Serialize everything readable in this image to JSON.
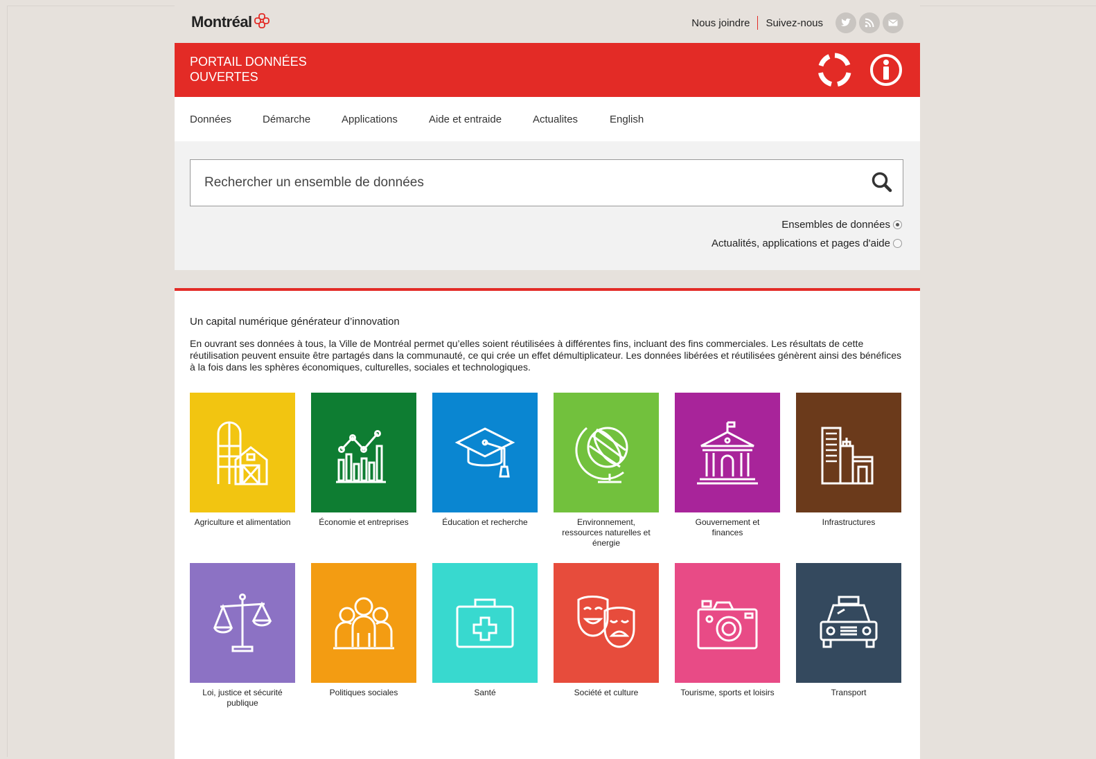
{
  "header": {
    "logo_text": "Montréal",
    "contact_label": "Nous joindre",
    "follow_label": "Suivez-nous",
    "social_icons": [
      "twitter-icon",
      "rss-icon",
      "email-icon"
    ]
  },
  "banner": {
    "title_line1": "PORTAIL DONNÉES",
    "title_line2": "OUVERTES",
    "icons": [
      "open-data-ring-icon",
      "info-icon"
    ]
  },
  "nav": {
    "items": [
      {
        "label": "Données"
      },
      {
        "label": "Démarche"
      },
      {
        "label": "Applications"
      },
      {
        "label": "Aide et entraide"
      },
      {
        "label": "Actualites"
      },
      {
        "label": "English"
      }
    ]
  },
  "search": {
    "placeholder": "Rechercher un ensemble de données",
    "options": [
      {
        "label": "Ensembles de données",
        "selected": true
      },
      {
        "label": "Actualités, applications et pages d'aide",
        "selected": false
      }
    ]
  },
  "intro": {
    "heading": "Un capital numérique générateur d’innovation",
    "paragraph": "En ouvrant ses données à tous, la Ville de Montréal permet qu’elles soient réutilisées à différentes fins, incluant des fins commerciales. Les résultats de cette réutilisation peuvent ensuite être partagés dans la communauté, ce qui crée un effet démultiplicateur. Les données libérées et réutilisées génèrent ainsi des bénéfices à la fois dans les sphères économiques, culturelles, sociales et technologiques."
  },
  "categories": [
    {
      "label": "Agriculture et alimentation",
      "color": "#f2c511",
      "icon": "farm-silo-icon"
    },
    {
      "label": "Économie et entreprises",
      "color": "#0e7d32",
      "icon": "bar-chart-trend-icon"
    },
    {
      "label": "Éducation et recherche",
      "color": "#0a86d1",
      "icon": "graduation-cap-icon"
    },
    {
      "label": "Environnement, ressources naturelles et énergie",
      "color": "#72c13d",
      "icon": "globe-icon"
    },
    {
      "label": "Gouvernement et finances",
      "color": "#a8249a",
      "icon": "government-building-icon"
    },
    {
      "label": "Infrastructures",
      "color": "#6b3a1b",
      "icon": "buildings-icon"
    },
    {
      "label": "Loi, justice et sécurité publique",
      "color": "#8c72c4",
      "icon": "scales-icon"
    },
    {
      "label": "Politiques sociales",
      "color": "#f39c12",
      "icon": "people-group-icon"
    },
    {
      "label": "Santé",
      "color": "#38d9cf",
      "icon": "medical-kit-icon"
    },
    {
      "label": "Société et culture",
      "color": "#e74c3c",
      "icon": "theater-masks-icon"
    },
    {
      "label": "Tourisme, sports et loisirs",
      "color": "#e84b86",
      "icon": "camera-icon"
    },
    {
      "label": "Transport",
      "color": "#34495e",
      "icon": "taxi-icon"
    }
  ]
}
